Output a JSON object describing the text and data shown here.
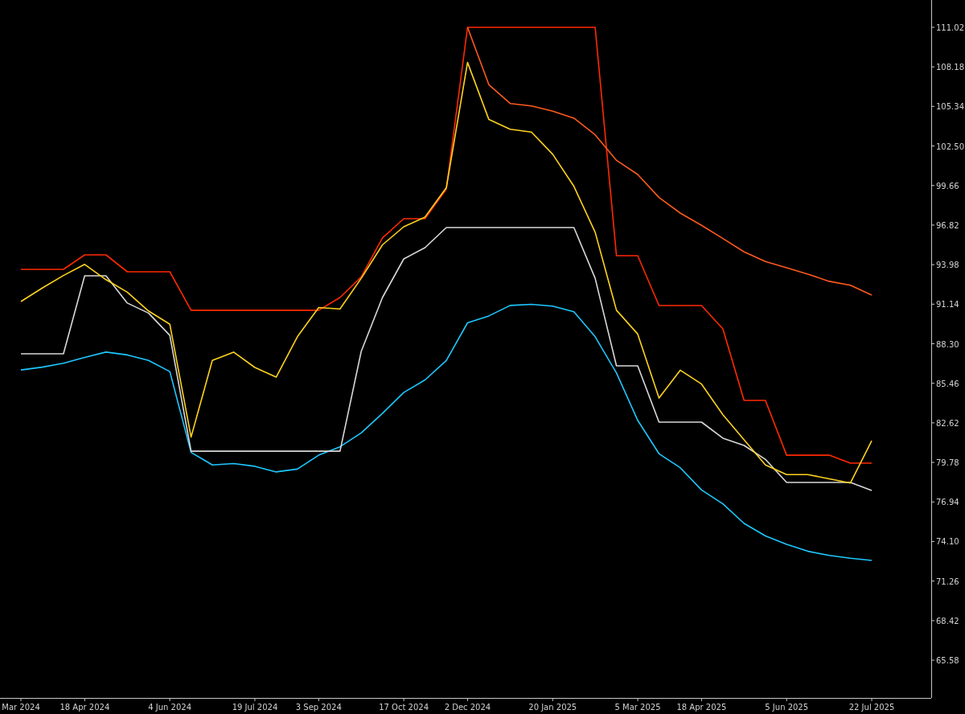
{
  "chart": {
    "chart_data": {
      "type": "line",
      "categories": [
        "Mar 2024",
        null,
        null,
        "18 Apr 2024",
        null,
        null,
        null,
        "4 Jun 2024",
        null,
        null,
        null,
        "19 Jul 2024",
        null,
        null,
        "3 Sep 2024",
        null,
        null,
        null,
        "17 Oct 2024",
        null,
        null,
        "2 Dec 2024",
        null,
        null,
        null,
        "20 Jan 2025",
        null,
        null,
        null,
        "5 Mar 2025",
        null,
        null,
        "18 Apr 2025",
        null,
        null,
        null,
        "5 Jun 2025",
        null,
        null,
        null,
        "22 Jul 2025"
      ],
      "ylim": [
        62.87,
        112.98
      ],
      "series": [
        {
          "color": "#1ec8ff",
          "values": [
            86.42,
            86.62,
            86.9,
            87.32,
            87.7,
            87.5,
            87.1,
            86.3,
            80.5,
            79.6,
            79.7,
            79.5,
            79.1,
            79.3,
            80.3,
            80.9,
            81.9,
            83.3,
            84.8,
            85.7,
            87.1,
            89.8,
            90.3,
            91.05,
            91.13,
            91.0,
            90.6,
            88.8,
            86.2,
            82.8,
            80.4,
            79.4,
            77.8,
            76.8,
            75.4,
            74.5,
            73.9,
            73.4,
            73.1,
            72.9,
            72.74
          ]
        },
        {
          "color": "#d8d8d8",
          "values": [
            87.58,
            87.58,
            87.58,
            93.18,
            93.18,
            91.22,
            90.5,
            88.9,
            80.59,
            80.59,
            80.59,
            80.59,
            80.59,
            80.59,
            80.59,
            80.59,
            87.75,
            91.62,
            94.39,
            95.2,
            96.64,
            96.64,
            96.64,
            96.64,
            96.64,
            96.64,
            96.64,
            93.0,
            86.71,
            86.71,
            82.67,
            82.67,
            82.67,
            81.52,
            81.0,
            80.0,
            78.34,
            78.34,
            78.34,
            78.34,
            77.76
          ]
        },
        {
          "color": "#ff2a00",
          "values": [
            93.64,
            93.64,
            93.64,
            94.68,
            94.68,
            93.47,
            93.47,
            93.47,
            90.7,
            90.7,
            90.7,
            90.7,
            90.7,
            90.7,
            90.7,
            91.62,
            93.1,
            95.9,
            97.28,
            97.28,
            99.4,
            111.02,
            111.02,
            111.02,
            111.02,
            111.02,
            111.02,
            111.02,
            94.62,
            94.62,
            91.04,
            91.04,
            91.04,
            89.37,
            84.23,
            84.23,
            80.3,
            80.3,
            80.3,
            79.73,
            79.73
          ]
        },
        {
          "color": "#ff5a1e",
          "values": [
            null,
            null,
            null,
            null,
            null,
            null,
            null,
            null,
            null,
            null,
            null,
            null,
            null,
            null,
            null,
            null,
            null,
            null,
            null,
            null,
            null,
            111.02,
            106.9,
            105.55,
            105.37,
            105.0,
            104.5,
            103.3,
            101.47,
            100.45,
            98.8,
            97.68,
            96.8,
            95.86,
            94.9,
            94.2,
            93.75,
            93.3,
            92.78,
            92.5,
            91.79
          ]
        },
        {
          "color": "#ffd21e",
          "values": [
            91.33,
            92.3,
            93.2,
            94.0,
            92.9,
            92.0,
            90.65,
            89.7,
            81.6,
            87.1,
            87.7,
            86.6,
            85.9,
            88.8,
            90.9,
            90.8,
            93.0,
            95.4,
            96.7,
            97.4,
            99.5,
            108.5,
            104.4,
            103.7,
            103.5,
            101.9,
            99.6,
            96.3,
            90.7,
            89.0,
            84.4,
            86.4,
            85.4,
            83.2,
            81.4,
            79.6,
            78.9,
            78.9,
            78.6,
            78.3,
            81.34
          ]
        }
      ],
      "yticks": [
        {
          "value": 111.02,
          "label": "111.02"
        },
        {
          "value": 108.18,
          "label": "108.18"
        },
        {
          "value": 105.34,
          "label": "105.34"
        },
        {
          "value": 102.5,
          "label": "102.50"
        },
        {
          "value": 99.66,
          "label": "99.66"
        },
        {
          "value": 96.82,
          "label": "96.82"
        },
        {
          "value": 93.98,
          "label": "93.98"
        },
        {
          "value": 91.14,
          "label": "91.14"
        },
        {
          "value": 88.3,
          "label": "88.30"
        },
        {
          "value": 85.46,
          "label": "85.46"
        },
        {
          "value": 82.62,
          "label": "82.62"
        },
        {
          "value": 79.78,
          "label": "79.78"
        },
        {
          "value": 76.94,
          "label": "76.94"
        },
        {
          "value": 74.1,
          "label": "74.10"
        },
        {
          "value": 71.26,
          "label": "71.26"
        },
        {
          "value": 68.42,
          "label": "68.42"
        },
        {
          "value": 65.58,
          "label": "65.58"
        }
      ]
    }
  }
}
